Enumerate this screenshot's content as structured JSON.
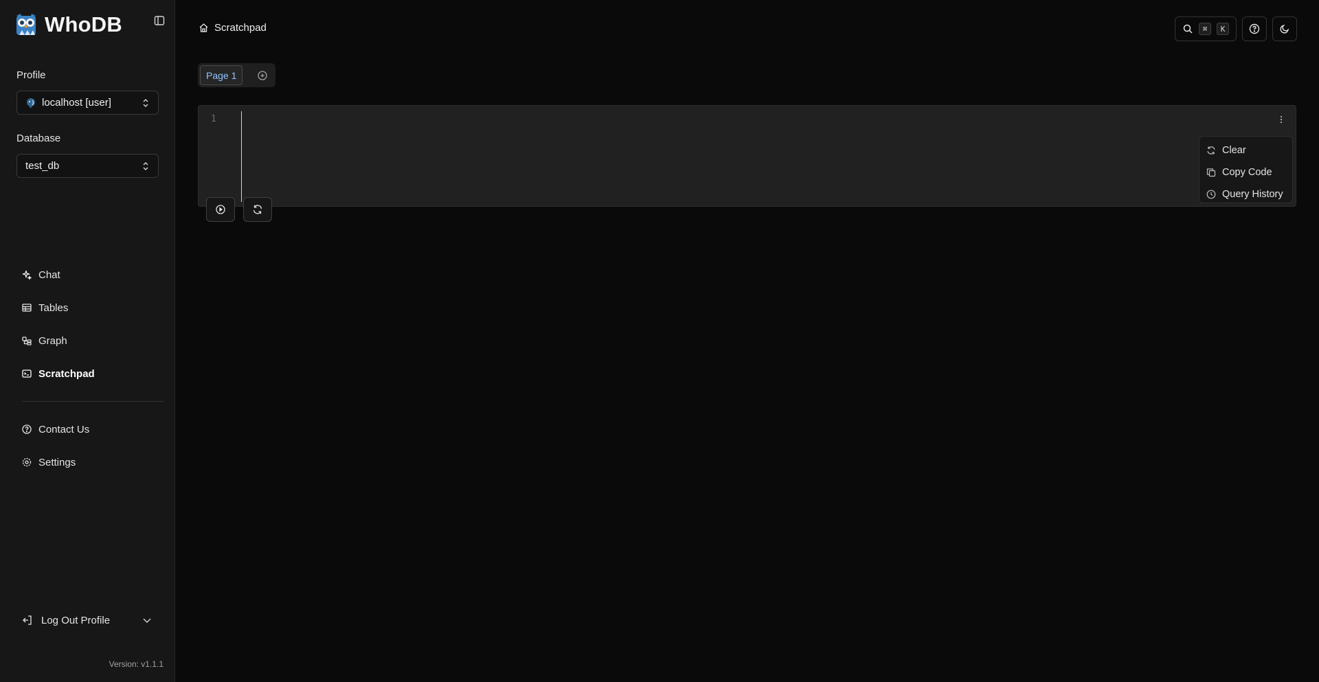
{
  "brand": {
    "name": "WhoDB"
  },
  "sidebar": {
    "profile_label": "Profile",
    "profile_value": "localhost [user]",
    "database_label": "Database",
    "database_value": "test_db",
    "nav": [
      {
        "label": "Chat",
        "icon": "sparkle-icon"
      },
      {
        "label": "Tables",
        "icon": "table-icon"
      },
      {
        "label": "Graph",
        "icon": "graph-icon"
      },
      {
        "label": "Scratchpad",
        "icon": "terminal-icon",
        "active": true
      }
    ],
    "secondary": [
      {
        "label": "Contact Us",
        "icon": "help-circle-icon"
      },
      {
        "label": "Settings",
        "icon": "gear-icon"
      }
    ],
    "logout_label": "Log Out Profile",
    "version": "Version: v1.1.1"
  },
  "header": {
    "breadcrumb": "Scratchpad",
    "shortcut_keys": [
      "⌘",
      "K"
    ]
  },
  "editor": {
    "pages": [
      {
        "label": "Page 1"
      }
    ],
    "line_number": "1",
    "menu": [
      {
        "label": "Clear",
        "icon": "refresh-icon"
      },
      {
        "label": "Copy Code",
        "icon": "copy-icon"
      },
      {
        "label": "Query History",
        "icon": "clock-icon"
      }
    ]
  },
  "colors": {
    "background": "#0a0a0a",
    "sidebar": "#171717",
    "editor": "#212121",
    "accent_tab_text": "#93c5fd"
  }
}
